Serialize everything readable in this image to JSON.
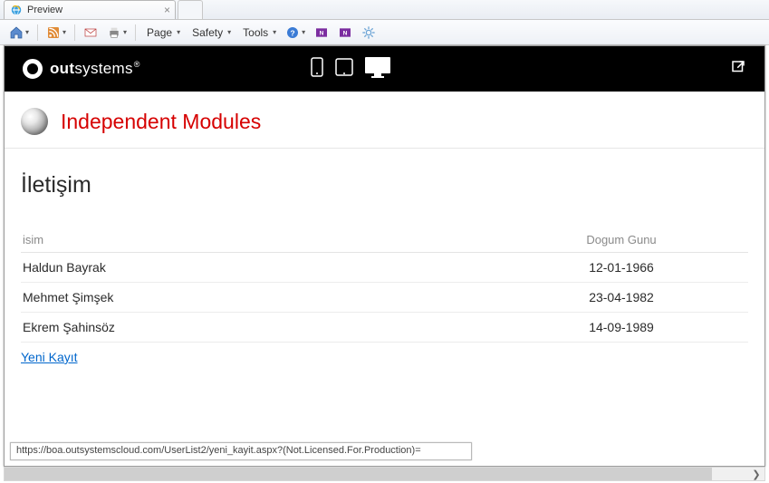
{
  "browser": {
    "tabTitle": "Preview",
    "menus": {
      "page": "Page",
      "safety": "Safety",
      "tools": "Tools"
    }
  },
  "header": {
    "brand": {
      "bold": "out",
      "light": "systems"
    },
    "moduleTitle": "Independent Modules"
  },
  "page": {
    "heading": "İletişim",
    "columns": {
      "name": "isim",
      "dob": "Dogum Gunu"
    },
    "rows": [
      {
        "name": "Haldun Bayrak",
        "dob": "12-01-1966"
      },
      {
        "name": "Mehmet Şimşek",
        "dob": "23-04-1982"
      },
      {
        "name": "Ekrem Şahinsöz",
        "dob": "14-09-1989"
      }
    ],
    "newLink": "Yeni Kayıt"
  },
  "statusUrl": "https://boa.outsystemscloud.com/UserList2/yeni_kayit.aspx?(Not.Licensed.For.Production)="
}
